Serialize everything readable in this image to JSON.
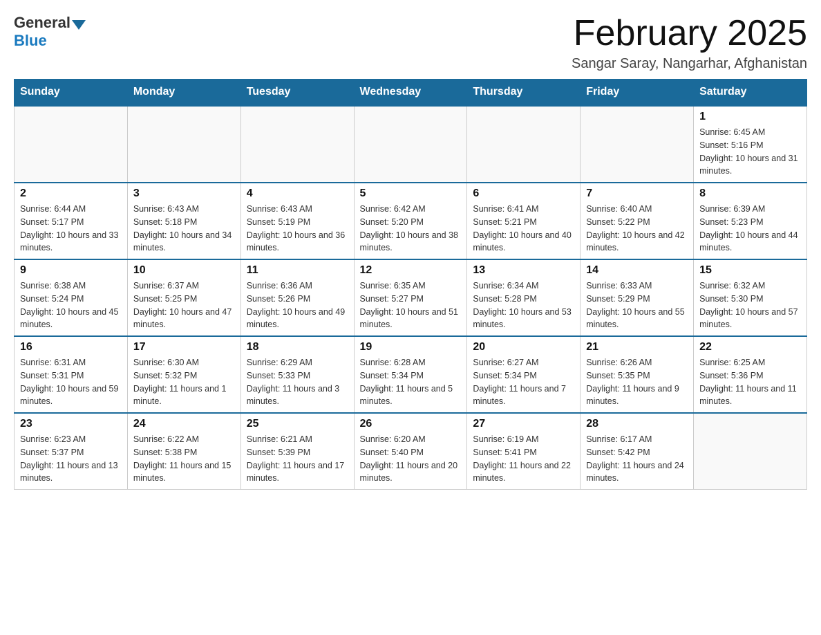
{
  "logo": {
    "general": "General",
    "blue": "Blue"
  },
  "title": "February 2025",
  "location": "Sangar Saray, Nangarhar, Afghanistan",
  "days_header": [
    "Sunday",
    "Monday",
    "Tuesday",
    "Wednesday",
    "Thursday",
    "Friday",
    "Saturday"
  ],
  "weeks": [
    [
      {
        "day": "",
        "info": ""
      },
      {
        "day": "",
        "info": ""
      },
      {
        "day": "",
        "info": ""
      },
      {
        "day": "",
        "info": ""
      },
      {
        "day": "",
        "info": ""
      },
      {
        "day": "",
        "info": ""
      },
      {
        "day": "1",
        "info": "Sunrise: 6:45 AM\nSunset: 5:16 PM\nDaylight: 10 hours and 31 minutes."
      }
    ],
    [
      {
        "day": "2",
        "info": "Sunrise: 6:44 AM\nSunset: 5:17 PM\nDaylight: 10 hours and 33 minutes."
      },
      {
        "day": "3",
        "info": "Sunrise: 6:43 AM\nSunset: 5:18 PM\nDaylight: 10 hours and 34 minutes."
      },
      {
        "day": "4",
        "info": "Sunrise: 6:43 AM\nSunset: 5:19 PM\nDaylight: 10 hours and 36 minutes."
      },
      {
        "day": "5",
        "info": "Sunrise: 6:42 AM\nSunset: 5:20 PM\nDaylight: 10 hours and 38 minutes."
      },
      {
        "day": "6",
        "info": "Sunrise: 6:41 AM\nSunset: 5:21 PM\nDaylight: 10 hours and 40 minutes."
      },
      {
        "day": "7",
        "info": "Sunrise: 6:40 AM\nSunset: 5:22 PM\nDaylight: 10 hours and 42 minutes."
      },
      {
        "day": "8",
        "info": "Sunrise: 6:39 AM\nSunset: 5:23 PM\nDaylight: 10 hours and 44 minutes."
      }
    ],
    [
      {
        "day": "9",
        "info": "Sunrise: 6:38 AM\nSunset: 5:24 PM\nDaylight: 10 hours and 45 minutes."
      },
      {
        "day": "10",
        "info": "Sunrise: 6:37 AM\nSunset: 5:25 PM\nDaylight: 10 hours and 47 minutes."
      },
      {
        "day": "11",
        "info": "Sunrise: 6:36 AM\nSunset: 5:26 PM\nDaylight: 10 hours and 49 minutes."
      },
      {
        "day": "12",
        "info": "Sunrise: 6:35 AM\nSunset: 5:27 PM\nDaylight: 10 hours and 51 minutes."
      },
      {
        "day": "13",
        "info": "Sunrise: 6:34 AM\nSunset: 5:28 PM\nDaylight: 10 hours and 53 minutes."
      },
      {
        "day": "14",
        "info": "Sunrise: 6:33 AM\nSunset: 5:29 PM\nDaylight: 10 hours and 55 minutes."
      },
      {
        "day": "15",
        "info": "Sunrise: 6:32 AM\nSunset: 5:30 PM\nDaylight: 10 hours and 57 minutes."
      }
    ],
    [
      {
        "day": "16",
        "info": "Sunrise: 6:31 AM\nSunset: 5:31 PM\nDaylight: 10 hours and 59 minutes."
      },
      {
        "day": "17",
        "info": "Sunrise: 6:30 AM\nSunset: 5:32 PM\nDaylight: 11 hours and 1 minute."
      },
      {
        "day": "18",
        "info": "Sunrise: 6:29 AM\nSunset: 5:33 PM\nDaylight: 11 hours and 3 minutes."
      },
      {
        "day": "19",
        "info": "Sunrise: 6:28 AM\nSunset: 5:34 PM\nDaylight: 11 hours and 5 minutes."
      },
      {
        "day": "20",
        "info": "Sunrise: 6:27 AM\nSunset: 5:34 PM\nDaylight: 11 hours and 7 minutes."
      },
      {
        "day": "21",
        "info": "Sunrise: 6:26 AM\nSunset: 5:35 PM\nDaylight: 11 hours and 9 minutes."
      },
      {
        "day": "22",
        "info": "Sunrise: 6:25 AM\nSunset: 5:36 PM\nDaylight: 11 hours and 11 minutes."
      }
    ],
    [
      {
        "day": "23",
        "info": "Sunrise: 6:23 AM\nSunset: 5:37 PM\nDaylight: 11 hours and 13 minutes."
      },
      {
        "day": "24",
        "info": "Sunrise: 6:22 AM\nSunset: 5:38 PM\nDaylight: 11 hours and 15 minutes."
      },
      {
        "day": "25",
        "info": "Sunrise: 6:21 AM\nSunset: 5:39 PM\nDaylight: 11 hours and 17 minutes."
      },
      {
        "day": "26",
        "info": "Sunrise: 6:20 AM\nSunset: 5:40 PM\nDaylight: 11 hours and 20 minutes."
      },
      {
        "day": "27",
        "info": "Sunrise: 6:19 AM\nSunset: 5:41 PM\nDaylight: 11 hours and 22 minutes."
      },
      {
        "day": "28",
        "info": "Sunrise: 6:17 AM\nSunset: 5:42 PM\nDaylight: 11 hours and 24 minutes."
      },
      {
        "day": "",
        "info": ""
      }
    ]
  ]
}
